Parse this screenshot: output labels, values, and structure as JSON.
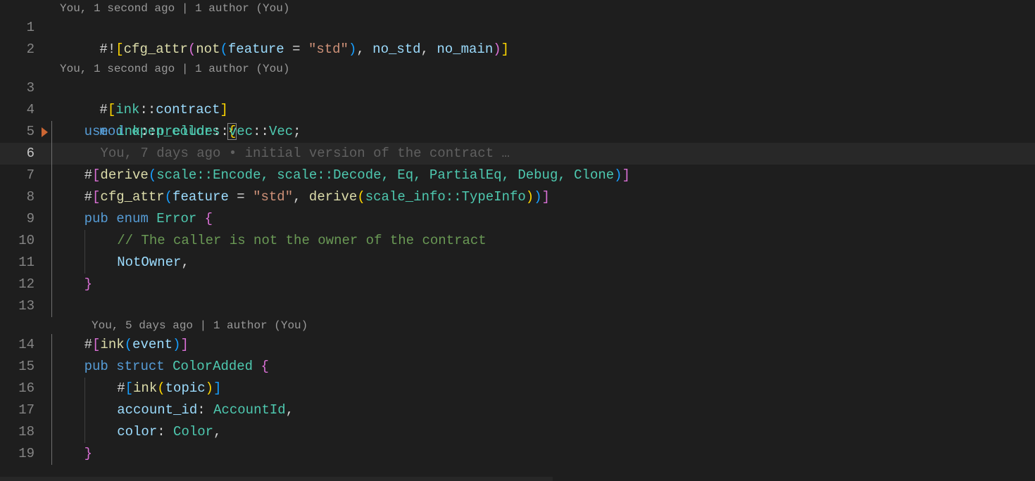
{
  "lens": {
    "top": "You, 1 second ago | 1 author (You)",
    "mid": "You, 1 second ago | 1 author (You)",
    "event": "You, 5 days ago | 1 author (You)"
  },
  "blame": {
    "prefix": "You, 7 days ago • ",
    "msg": "initial version of the contract …"
  },
  "lineNumbers": [
    "1",
    "2",
    "3",
    "4",
    "5",
    "6",
    "7",
    "8",
    "9",
    "10",
    "11",
    "12",
    "13",
    "14",
    "15",
    "16",
    "17",
    "18",
    "19"
  ],
  "tok": {
    "l1": {
      "hash": "#!",
      "open": "[",
      "attr": "cfg_attr",
      "p1": "(",
      "fn": "not",
      "p2": "(",
      "arg": "feature",
      "eq": " = ",
      "str": "\"std\"",
      "p2c": ")",
      "c1": ", ",
      "v1": "no_std",
      "c2": ", ",
      "v2": "no_main",
      "p1c": ")",
      "close": "]"
    },
    "l3": {
      "hash": "#",
      "open": "[",
      "ns": "ink",
      "dup": "::",
      "id": "contract",
      "close": "]"
    },
    "l4": {
      "kw": "mod",
      "sp": " ",
      "name": "open_colors",
      "sp2": " ",
      "brace": "{"
    },
    "l5": {
      "kw": "use",
      "sp": " ",
      "p1": "ink",
      "d": "::",
      "p2": "prelude",
      "p3": "vec",
      "ty": "Vec",
      "semi": ";"
    },
    "l7": {
      "hash": "#",
      "open": "[",
      "fn": "derive",
      "p": "(",
      "arg": "scale::Encode, scale::Decode, Eq, PartialEq, Debug, Clone",
      "pc": ")",
      "close": "]"
    },
    "l8": {
      "hash": "#",
      "open": "[",
      "fn": "cfg_attr",
      "p": "(",
      "arg1": "feature",
      "eq": " = ",
      "str": "\"std\"",
      "c": ", ",
      "fn2": "derive",
      "p2": "(",
      "arg2": "scale_info::TypeInfo",
      "p2c": ")",
      "pc": ")",
      "close": "]"
    },
    "l9": {
      "kw1": "pub",
      "kw2": "enum",
      "name": "Error",
      "brace": "{"
    },
    "l10": {
      "cmt": "// The caller is not the owner of the contract"
    },
    "l11": {
      "name": "NotOwner",
      "comma": ","
    },
    "l12": {
      "brace": "}"
    },
    "l14": {
      "hash": "#",
      "open": "[",
      "fn": "ink",
      "p": "(",
      "arg": "event",
      "pc": ")",
      "close": "]"
    },
    "l15": {
      "kw1": "pub",
      "kw2": "struct",
      "name": "ColorAdded",
      "brace": "{"
    },
    "l16": {
      "hash": "#",
      "open": "[",
      "fn": "ink",
      "p": "(",
      "arg": "topic",
      "pc": ")",
      "close": "]"
    },
    "l17": {
      "field": "account_id",
      "colon": ": ",
      "ty": "AccountId",
      "comma": ","
    },
    "l18": {
      "field": "color",
      "colon": ": ",
      "ty": "Color",
      "comma": ","
    },
    "l19": {
      "brace": "}"
    }
  }
}
